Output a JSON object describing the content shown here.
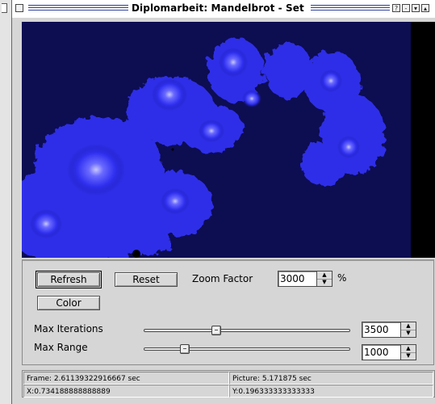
{
  "window": {
    "title": "Diplomarbeit: Mandelbrot - Set",
    "buttons": [
      "?",
      "-",
      "▾",
      "▴"
    ]
  },
  "canvas": {
    "background": "#0a0a4a",
    "fractal_color": "#3a3aff",
    "highlight_color": "#c8c8ff"
  },
  "controls": {
    "refresh_label": "Refresh",
    "reset_label": "Reset",
    "color_label": "Color",
    "zoom_label": "Zoom Factor",
    "zoom_value": "3000",
    "zoom_unit": "%",
    "max_iterations_label": "Max Iterations",
    "max_iterations_value": "3500",
    "max_iterations_slider_fraction": 0.35,
    "max_range_label": "Max Range",
    "max_range_value": "1000",
    "max_range_slider_fraction": 0.2
  },
  "status": {
    "frame": "Frame: 2.61139322916667 sec",
    "picture": "Picture: 5.171875 sec",
    "x": "X:0.734188888888889",
    "y": "Y:0.196333333333333"
  }
}
